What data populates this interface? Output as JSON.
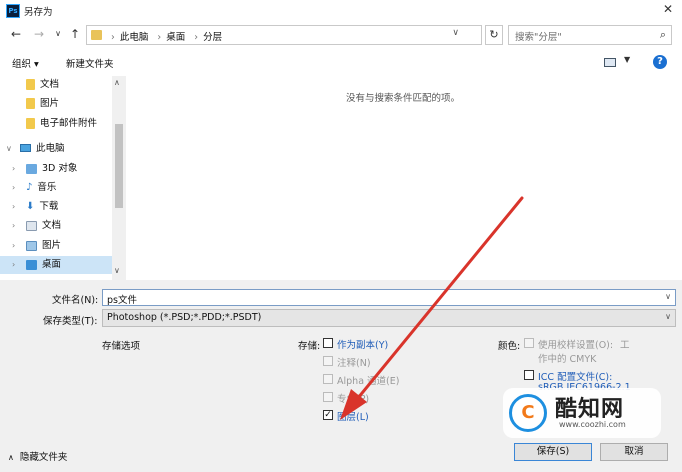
{
  "title": "另存为",
  "nav": {
    "back": "←",
    "forward": "→",
    "recent": "∨",
    "up": "↑"
  },
  "address": {
    "crumbs": [
      "此电脑",
      "桌面",
      "分层"
    ]
  },
  "search": {
    "placeholder": "搜索\"分层\""
  },
  "toolbar": {
    "organize": "组织 ▾",
    "new_folder": "新建文件夹"
  },
  "tree": {
    "items": [
      {
        "label": "文档",
        "icon": "folder-icon"
      },
      {
        "label": "图片",
        "icon": "folder-icon"
      },
      {
        "label": "电子邮件附件",
        "icon": "folder-icon"
      },
      {
        "label": "此电脑",
        "icon": "computer-icon"
      },
      {
        "label": "3D 对象",
        "icon": "3d-objects-icon"
      },
      {
        "label": "音乐",
        "icon": "music-icon"
      },
      {
        "label": "下载",
        "icon": "download-icon"
      },
      {
        "label": "文档",
        "icon": "documents-icon"
      },
      {
        "label": "图片",
        "icon": "pictures-icon"
      },
      {
        "label": "桌面",
        "icon": "desktop-icon",
        "selected": true
      }
    ]
  },
  "main": {
    "empty_message": "没有与搜索条件匹配的项。"
  },
  "filename": {
    "label": "文件名(N):",
    "value": "ps文件"
  },
  "filetype": {
    "label": "保存类型(T):",
    "value": "Photoshop (*.PSD;*.PDD;*.PSDT)"
  },
  "options": {
    "section_label": "存储选项",
    "save_label": "存储:",
    "as_copy": "作为副本(Y)",
    "annotations": "注释(N)",
    "alpha": "Alpha 通道(E)",
    "spot": "专色(P)",
    "layers": "图层(L)",
    "layers_checked": true,
    "color_label": "颜色:",
    "proof_setup": "使用校样设置(O):",
    "proof_note_a": "工",
    "proof_note_b": "作中的 CMYK",
    "icc": "ICC 配置文件(C):",
    "icc_value": "sRGB IEC61966-2.1"
  },
  "watermark": {
    "text": "酷知网",
    "url": "www.coozhi.com",
    "letter": "C"
  },
  "footer": {
    "hide_folders": "隐藏文件夹",
    "save": "保存(S)",
    "cancel": "取消"
  },
  "colors": {
    "accent": "#1a6fd1",
    "selection": "#cce4f7",
    "arrow": "#d9342b"
  }
}
